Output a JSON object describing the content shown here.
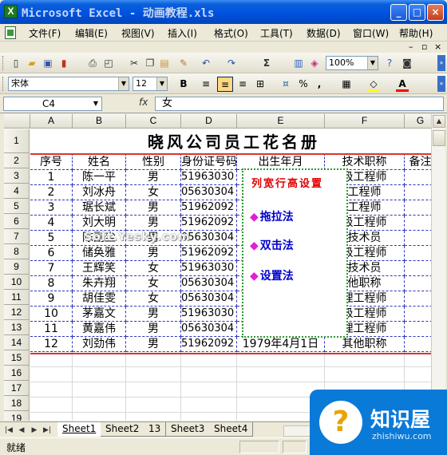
{
  "window": {
    "title": "Microsoft Excel - 动画教程.xls",
    "minimize_glyph": "_",
    "maximize_glyph": "□",
    "close_glyph": "×"
  },
  "menu": [
    "文件(F)",
    "编辑(E)",
    "视图(V)",
    "插入(I)",
    "格式(O)",
    "工具(T)",
    "数据(D)",
    "窗口(W)",
    "帮助(H)"
  ],
  "mdi_controls": {
    "minimize": "–",
    "restore": "▫",
    "close": "×"
  },
  "toolbar": {
    "zoom": "100%",
    "autosum_glyph": "Σ"
  },
  "format_toolbar": {
    "font_name": "宋体",
    "font_size": "12",
    "bold": "B",
    "percent": "%",
    "comma": ",",
    "font_color_glyph": "A",
    "fill_color": "#ffff00",
    "font_color": "#ff0000"
  },
  "formula_bar": {
    "name_box": "C4",
    "fx": "fx",
    "content": "女"
  },
  "columns": [
    "A",
    "B",
    "C",
    "D",
    "E",
    "F",
    "G"
  ],
  "rows": [
    "1",
    "2",
    "3",
    "4",
    "5",
    "6",
    "7",
    "8",
    "9",
    "10",
    "11",
    "12",
    "13",
    "14",
    "15",
    "16",
    "17",
    "18",
    "19"
  ],
  "sheet": {
    "title": "晓风公司员工花名册",
    "headers": [
      "序号",
      "姓名",
      "性别",
      "身份证号码",
      "出生年月",
      "技术职称",
      "备注"
    ],
    "records": [
      [
        "1",
        "陈一平",
        "男",
        "51963030",
        "",
        "级工程师"
      ],
      [
        "2",
        "刘冰舟",
        "女",
        "05630304",
        "",
        "工程师"
      ],
      [
        "3",
        "琚长斌",
        "男",
        "51962092",
        "",
        "工程师"
      ],
      [
        "4",
        "刘大明",
        "男",
        "51962092",
        "",
        "级工程师"
      ],
      [
        "5",
        "陈副尘",
        "男",
        "05630304",
        "",
        "技术员"
      ],
      [
        "6",
        "储奂雅",
        "男",
        "51962092",
        "",
        "级工程师"
      ],
      [
        "7",
        "王辉笑",
        "女",
        "51963030",
        "",
        "技术员"
      ],
      [
        "8",
        "朱卉翔",
        "女",
        "05630304",
        "",
        "他职称"
      ],
      [
        "9",
        "胡佳雯",
        "女",
        "05630304",
        "",
        "理工程师"
      ],
      [
        "10",
        "茅嘉文",
        "男",
        "51963030",
        "",
        "级工程师"
      ],
      [
        "11",
        "黄嘉伟",
        "男",
        "05630304",
        "",
        "理工程师"
      ],
      [
        "12",
        "刘劲伟",
        "男",
        "51962092",
        "1979年4月1日",
        "其他职称"
      ]
    ]
  },
  "overlay": {
    "title": "列宽行高设置",
    "items": [
      "拖拉法",
      "双击法",
      "设置法"
    ],
    "bullet": "◆"
  },
  "watermark": "Soft.Yesky.com",
  "tabs": [
    "Sheet1",
    "Sheet2",
    "13",
    "Sheet3",
    "Sheet4"
  ],
  "status": "就绪",
  "logo": {
    "name": "知识屋",
    "domain": "zhishiwu.com",
    "glyph": "?"
  }
}
